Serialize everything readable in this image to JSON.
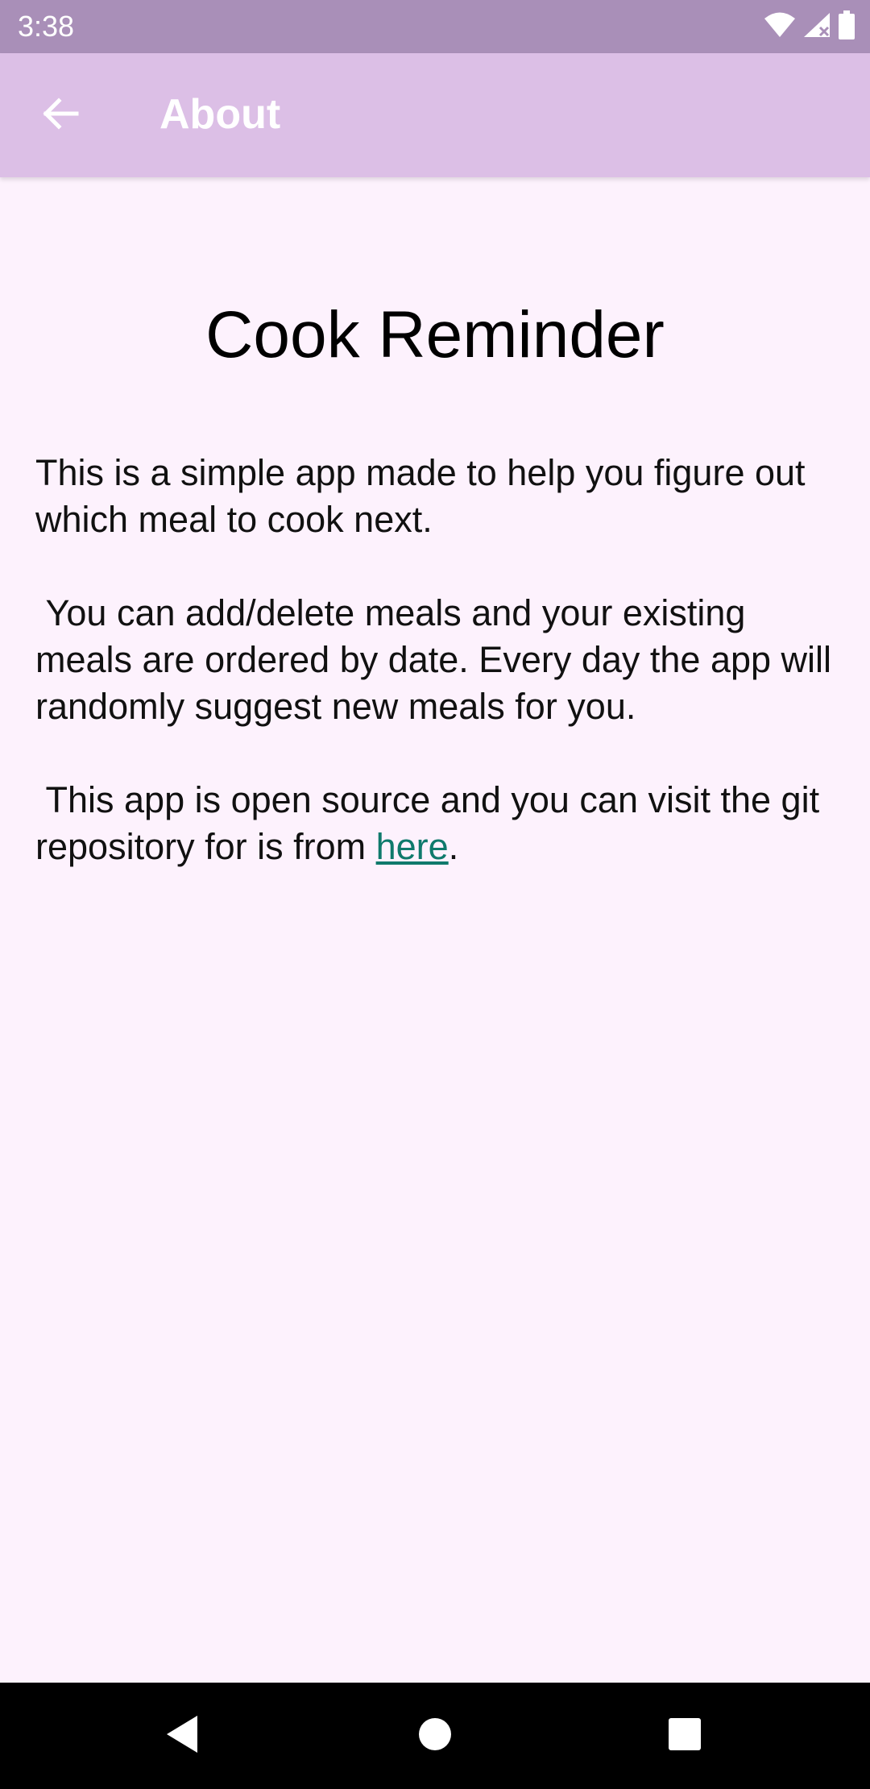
{
  "status_bar": {
    "time": "3:38",
    "icons": [
      "wifi-icon",
      "cellular-signal-icon",
      "battery-icon"
    ]
  },
  "app_bar": {
    "back_icon": "arrow-back-icon",
    "title": "About"
  },
  "content": {
    "app_name": "Cook Reminder",
    "paragraph1": "This is a simple app made to help you figure out which meal to cook next.",
    "paragraph2": " You can add/delete meals and your existing meals are ordered by date. Every day the app will randomly suggest new meals for you.",
    "paragraph3_prefix": " This app is open source and you can visit the git repository for is from ",
    "link_text": "here",
    "paragraph3_suffix": "."
  },
  "nav_bar": {
    "icons": [
      "nav-back-icon",
      "nav-home-icon",
      "nav-recents-icon"
    ]
  },
  "colors": {
    "status_bar": "#a98fb8",
    "app_bar": "#dcbfe6",
    "background": "#fdf2fd",
    "link": "#0f7a6c"
  }
}
